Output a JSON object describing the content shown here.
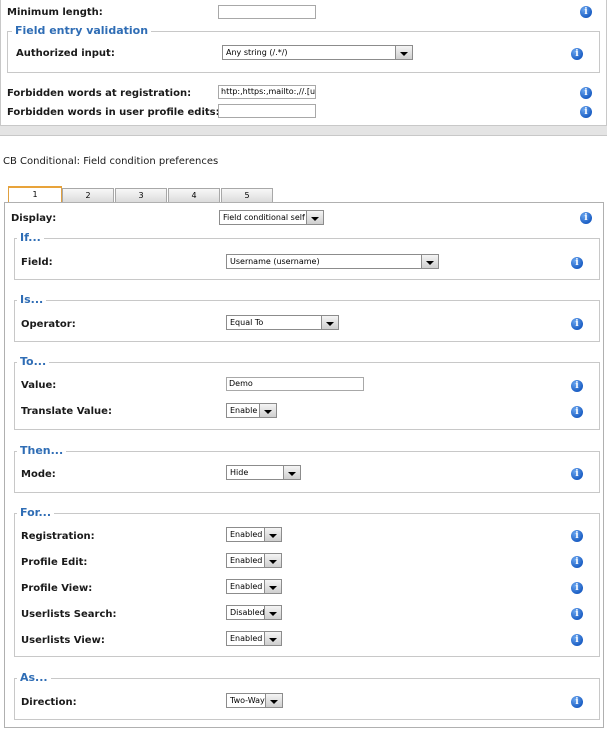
{
  "top": {
    "min_length_label": "Minimum length:",
    "min_length_value": "",
    "validation_legend": "Field entry validation",
    "authorized_label": "Authorized input:",
    "authorized_value": "Any string (/.*/)",
    "forbidden_reg_label": "Forbidden words at registration:",
    "forbidden_reg_value": "http:,https:,mailto:,//.[url],<a,</a>,&#",
    "forbidden_edit_label": "Forbidden words in user profile edits:",
    "forbidden_edit_value": ""
  },
  "cond": {
    "title": "CB Conditional: Field condition preferences",
    "tabs": [
      "1",
      "2",
      "3",
      "4",
      "5"
    ],
    "display_label": "Display:",
    "display_value": "Field conditional self",
    "if_legend": "If...",
    "field_label": "Field:",
    "field_value": "Username (username)",
    "is_legend": "Is...",
    "operator_label": "Operator:",
    "operator_value": "Equal To",
    "to_legend": "To...",
    "value_label": "Value:",
    "value_value": "Demo",
    "translate_label": "Translate Value:",
    "translate_value": "Enable",
    "then_legend": "Then...",
    "mode_label": "Mode:",
    "mode_value": "Hide",
    "for_legend": "For...",
    "registration_label": "Registration:",
    "registration_value": "Enabled",
    "profile_edit_label": "Profile Edit:",
    "profile_edit_value": "Enabled",
    "profile_view_label": "Profile View:",
    "profile_view_value": "Enabled",
    "ul_search_label": "Userlists Search:",
    "ul_search_value": "Disabled",
    "ul_view_label": "Userlists View:",
    "ul_view_value": "Enabled",
    "as_legend": "As...",
    "direction_label": "Direction:",
    "direction_value": "Two-Way"
  },
  "icons": {
    "info": "info-icon",
    "info_glyph": "i",
    "dropdown": "chevron-down-icon"
  },
  "colors": {
    "legend": "#2f6db5",
    "tab_active": "#e8a33a",
    "info": "#1c5fc4"
  }
}
